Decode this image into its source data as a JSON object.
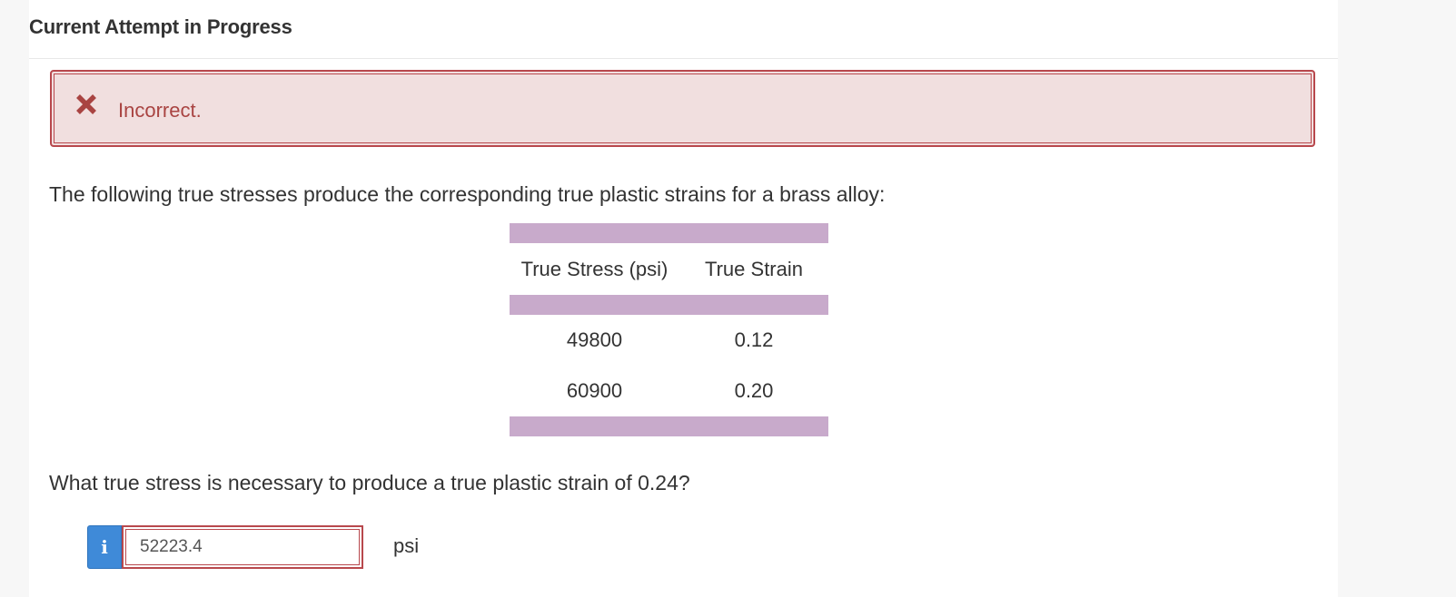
{
  "header": {
    "title": "Current Attempt in Progress"
  },
  "feedback": {
    "status_text": "Incorrect.",
    "icon": "x-mark-icon",
    "color": "#a94442"
  },
  "problem": {
    "intro": "The following true stresses produce the corresponding true plastic strains for a brass alloy:",
    "table": {
      "headers": [
        "True Stress (psi)",
        "True Strain"
      ],
      "rows": [
        [
          "49800",
          "0.12"
        ],
        [
          "60900",
          "0.20"
        ]
      ]
    },
    "question": "What true stress is necessary to produce a true plastic strain of 0.24?"
  },
  "answer": {
    "info_button_label": "i",
    "value": "52223.4",
    "unit": "psi"
  },
  "colors": {
    "table_band": "#c8aacb",
    "error_border": "#b8484d",
    "error_background": "#f1dfdf",
    "info_button": "#3f8ad8"
  }
}
